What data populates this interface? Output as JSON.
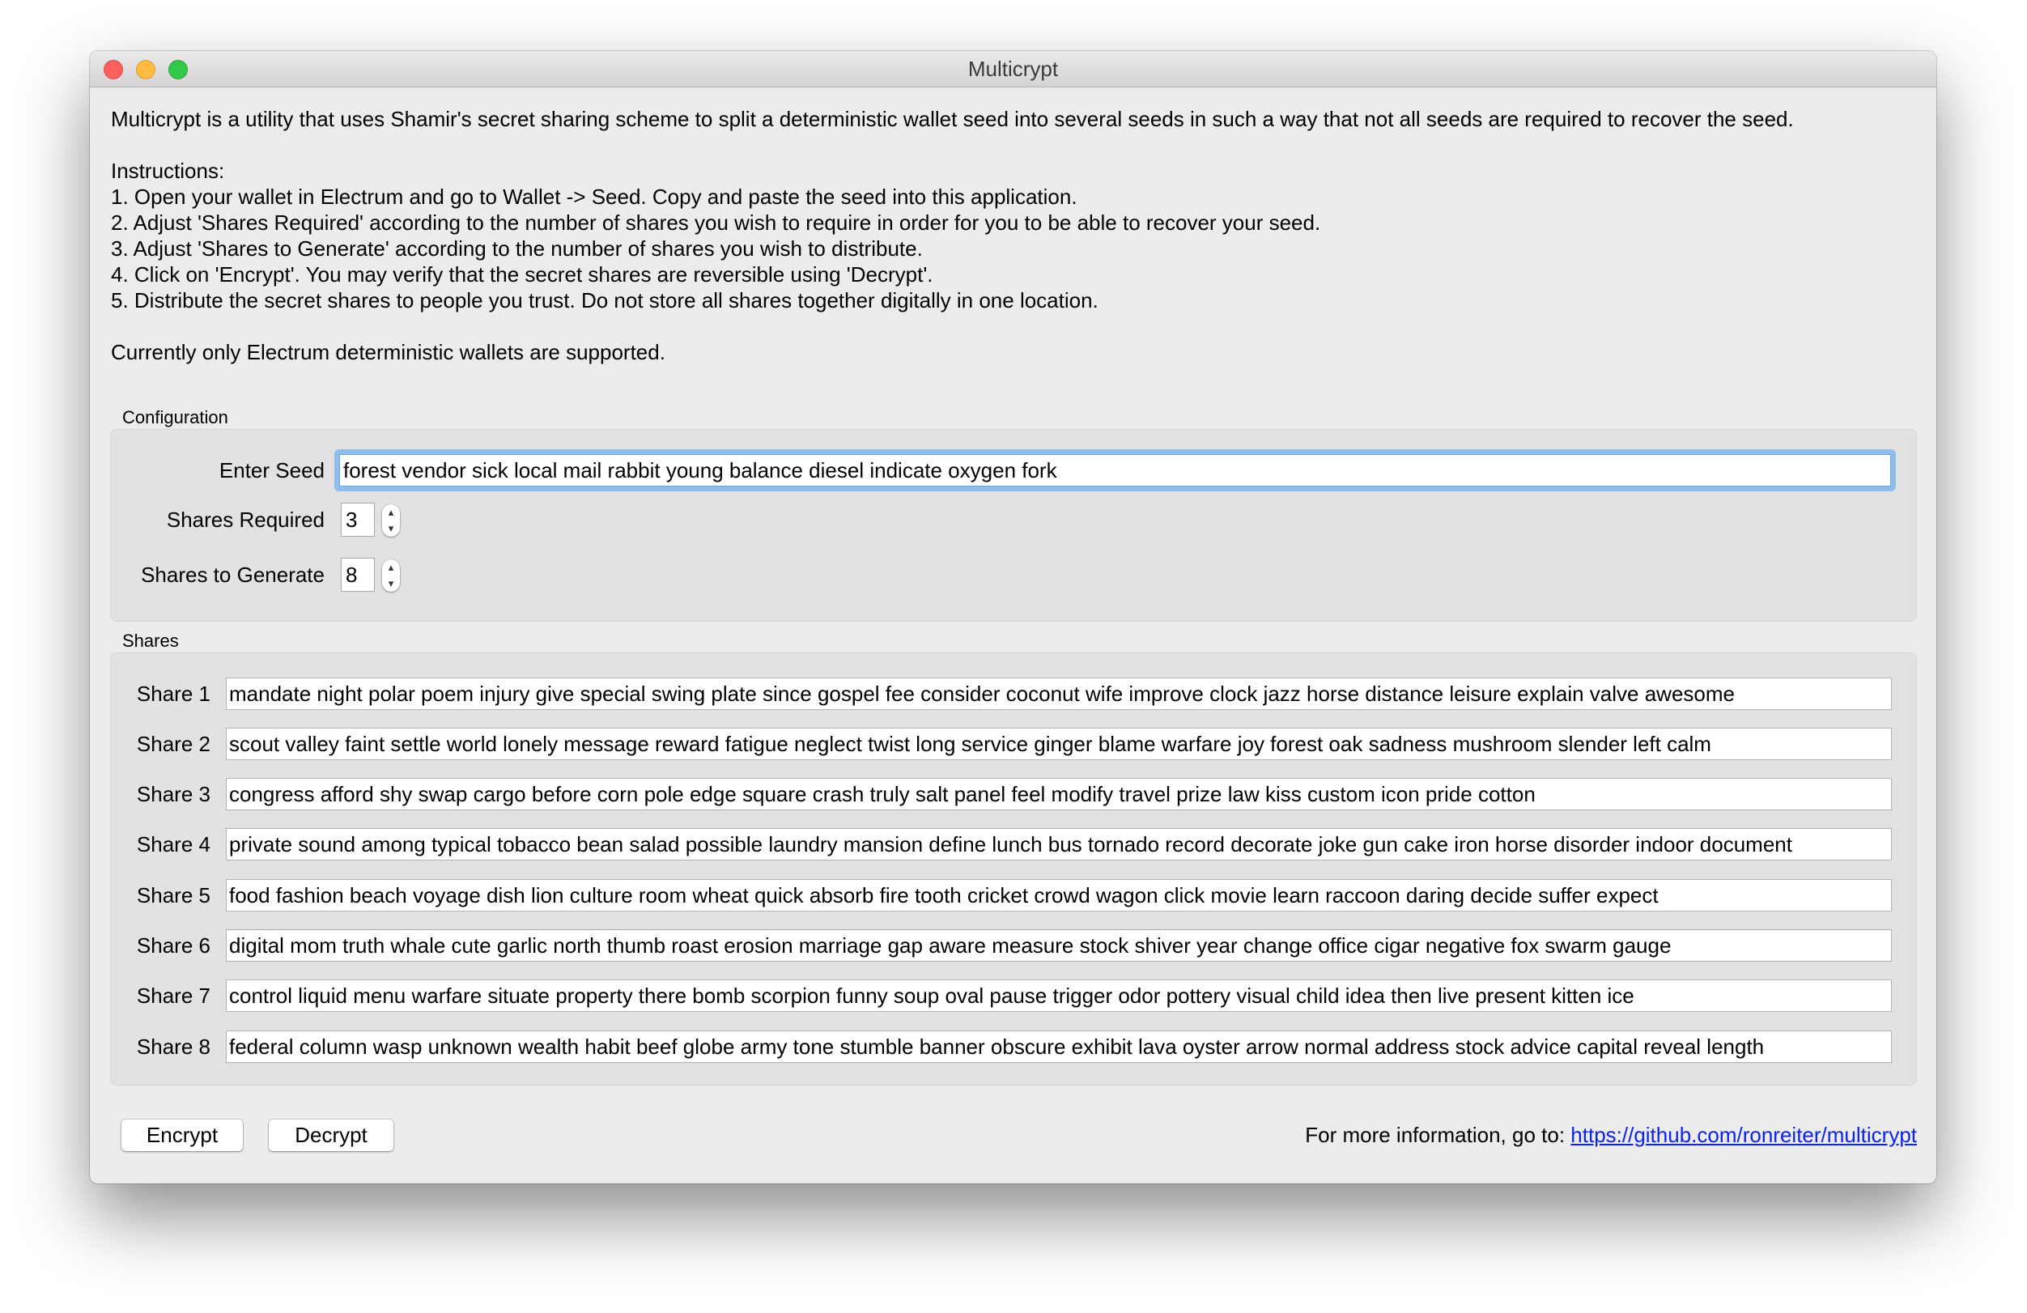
{
  "window": {
    "title": "Multicrypt"
  },
  "description": {
    "intro": "Multicrypt is a utility that uses Shamir's secret sharing scheme to split a deterministic wallet seed into several seeds in such a way that not all seeds are required to recover the seed.",
    "instructions_heading": "Instructions:",
    "steps": [
      "1. Open your wallet in Electrum and go to Wallet -> Seed. Copy and paste the seed into this application.",
      "2. Adjust 'Shares Required' according to the number of shares you wish to require in order for you to be able to recover your seed.",
      "3. Adjust 'Shares to Generate' according to the number of shares you wish to distribute.",
      "4. Click on 'Encrypt'. You may verify that the secret shares are reversible using 'Decrypt'.",
      "5. Distribute the secret shares to people you trust. Do not store all shares together digitally in one location."
    ],
    "note": "Currently only Electrum deterministic wallets are supported."
  },
  "configuration": {
    "group_label": "Configuration",
    "seed_label": "Enter Seed",
    "seed_value": "forest vendor sick local mail rabbit young balance diesel indicate oxygen fork",
    "shares_required_label": "Shares Required",
    "shares_required_value": "3",
    "shares_to_generate_label": "Shares to Generate",
    "shares_to_generate_value": "8"
  },
  "shares": {
    "group_label": "Shares",
    "items": [
      {
        "label": "Share 1",
        "value": "mandate night polar poem injury give special swing plate since gospel fee consider coconut wife improve clock jazz horse distance leisure explain valve awesome"
      },
      {
        "label": "Share 2",
        "value": "scout valley faint settle world lonely message reward fatigue neglect twist long service ginger blame warfare joy forest oak sadness mushroom slender left calm"
      },
      {
        "label": "Share 3",
        "value": "congress afford shy swap cargo before corn pole edge square crash truly salt panel feel modify travel prize law kiss custom icon pride cotton"
      },
      {
        "label": "Share 4",
        "value": "private sound among typical tobacco bean salad possible laundry mansion define lunch bus tornado record decorate joke gun cake iron horse disorder indoor document"
      },
      {
        "label": "Share 5",
        "value": "food fashion beach voyage dish lion culture room wheat quick absorb fire tooth cricket crowd wagon click movie learn raccoon daring decide suffer expect"
      },
      {
        "label": "Share 6",
        "value": "digital mom truth whale cute garlic north thumb roast erosion marriage gap aware measure stock shiver year change office cigar negative fox swarm gauge"
      },
      {
        "label": "Share 7",
        "value": "control liquid menu warfare situate property there bomb scorpion funny soup oval pause trigger odor pottery visual child idea then live present kitten ice"
      },
      {
        "label": "Share 8",
        "value": "federal column wasp unknown wealth habit beef globe army tone stumble banner obscure exhibit lava oyster arrow normal address stock advice capital reveal length"
      }
    ]
  },
  "actions": {
    "encrypt_label": "Encrypt",
    "decrypt_label": "Decrypt"
  },
  "footer": {
    "info_text": "For more information, go to: ",
    "link_text": "https://github.com/ronreiter/multicrypt"
  },
  "icons": {
    "stepper_up": "▴",
    "stepper_down": "▾"
  }
}
